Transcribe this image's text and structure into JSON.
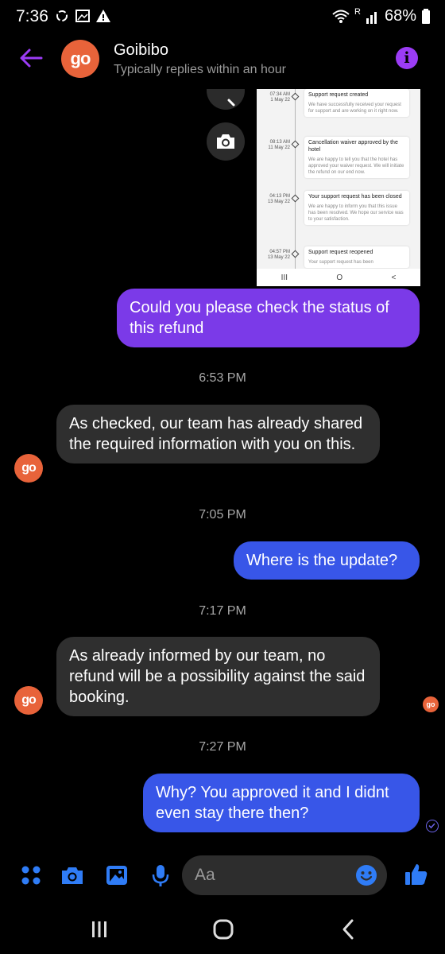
{
  "status_bar": {
    "time": "7:36",
    "network_label": "R",
    "battery": "68%"
  },
  "header": {
    "avatar_text": "go",
    "name": "Goibibo",
    "subtitle": "Typically replies within an hour"
  },
  "attachment": {
    "items": [
      {
        "time": "07:34 AM",
        "date": "1 May 22",
        "title": "Support request created",
        "body": "We have successfully received your request for support and are working on it right now."
      },
      {
        "time": "08:13 AM",
        "date": "11 May 22",
        "title": "Cancellation waiver approved by the hotel",
        "body": "We are happy to tell you that the hotel has approved your waiver request. We will initiate the refund on our end now."
      },
      {
        "time": "04:13 PM",
        "date": "13 May 22",
        "title": "Your support request has been closed",
        "body": "We are happy to inform you that this issue has been resolved. We hope our service was to your satisfaction."
      },
      {
        "time": "04:57 PM",
        "date": "13 May 22",
        "title": "Support request reopened",
        "body": "Your support request has been"
      }
    ],
    "nav": [
      "III",
      "O",
      "<"
    ]
  },
  "messages": [
    {
      "text": "Could you please check the status of this refund"
    },
    {
      "text": "6:53 PM"
    },
    {
      "text": "As checked, our team has already shared the required information with you on this."
    },
    {
      "text": "7:05 PM"
    },
    {
      "text": "Where is the update?"
    },
    {
      "text": "7:17 PM"
    },
    {
      "text": "As already informed by our team, no refund will be a possibility against the said booking."
    },
    {
      "text": "7:27 PM"
    },
    {
      "text": "Why? You approved it and I didnt even stay there then?"
    }
  ],
  "composer": {
    "placeholder": "Aa"
  },
  "colors": {
    "accent_purple": "#7b3ae8",
    "bubble_blue": "#3856e8",
    "bubble_incoming": "#2f2f2f",
    "brand_orange": "#e8633a",
    "icon_blue": "#2f7cf6"
  }
}
